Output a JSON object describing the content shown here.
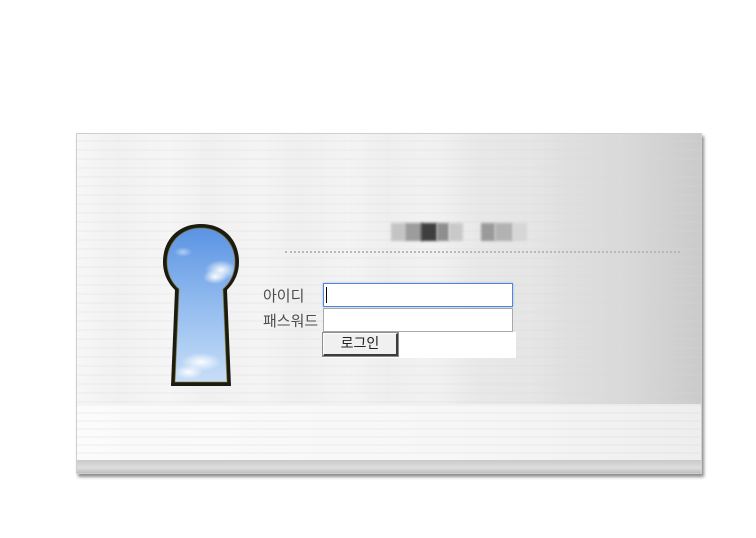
{
  "login": {
    "id_label": "아이디",
    "password_label": "패스워드",
    "id_value": "",
    "password_value": "",
    "button_label": "로그인"
  },
  "colors": {
    "focus_border": "#4f86d9",
    "keyhole_frame": "#1a1a12",
    "sky_top": "#6da1e6",
    "sky_bottom": "#bcd6f5"
  },
  "icons": {
    "keyhole": "keyhole-icon"
  }
}
